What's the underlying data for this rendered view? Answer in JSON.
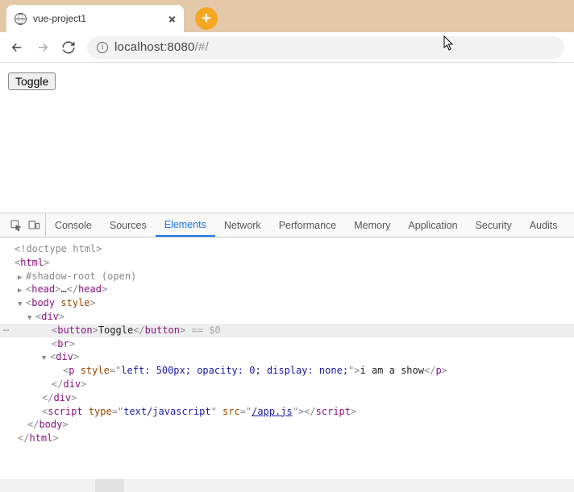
{
  "browser": {
    "tab_title": "vue-project1",
    "new_tab_glyph": "+",
    "url_host": "localhost:8080",
    "url_path": "/#/"
  },
  "page": {
    "toggle_label": "Toggle"
  },
  "devtools": {
    "tabs": [
      "Console",
      "Sources",
      "Elements",
      "Network",
      "Performance",
      "Memory",
      "Application",
      "Security",
      "Audits"
    ],
    "active_tab_index": 2,
    "dom": {
      "doctype": "<!doctype html>",
      "html_open": "html",
      "shadow_root": "#shadow-root (open)",
      "head_open": "head",
      "head_ellipsis": "…",
      "head_close": "head",
      "body_open": "body",
      "body_attr": "style",
      "div": "div",
      "button": "button",
      "button_text": "Toggle",
      "eq0": " == $0",
      "br": "br",
      "p": "p",
      "p_style_name": "style",
      "p_style_val": "left: 500px; opacity: 0; display: none;",
      "p_text": "i am a show",
      "script": "script",
      "script_type_name": "type",
      "script_type_val": "text/javascript",
      "script_src_name": "src",
      "script_src_val": "/app.js",
      "html_close": "html"
    }
  }
}
